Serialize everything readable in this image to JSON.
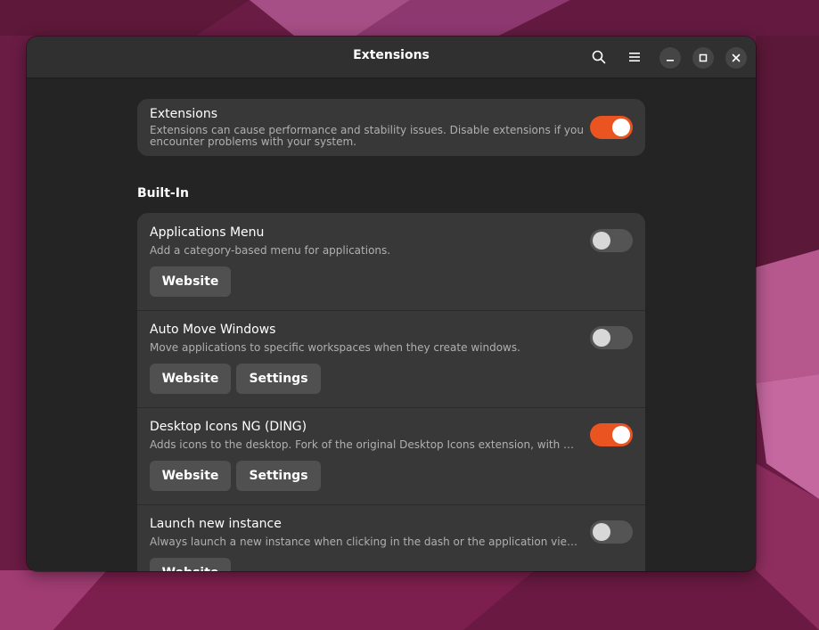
{
  "window": {
    "title": "Extensions",
    "icons": {
      "search": "search-icon",
      "menu": "hamburger-menu-icon",
      "minimize": "minimize-icon",
      "maximize": "maximize-icon",
      "close": "close-icon"
    }
  },
  "global_toggle": {
    "title": "Extensions",
    "subtitle_line1": "Extensions can cause performance and stability issues. Disable extensions if you",
    "subtitle_line2": "encounter problems with your system.",
    "enabled": true
  },
  "section": {
    "heading": "Built-In"
  },
  "extensions": [
    {
      "name": "Applications Menu",
      "description": "Add a category-based menu for applications.",
      "enabled": false,
      "website_label": "Website",
      "settings_label": ""
    },
    {
      "name": "Auto Move Windows",
      "description": "Move applications to specific workspaces when they create windows.",
      "enabled": false,
      "website_label": "Website",
      "settings_label": "Settings"
    },
    {
      "name": "Desktop Icons NG (DING)",
      "description": "Adds icons to the desktop. Fork of the original Desktop Icons extension, with several enhancements",
      "enabled": true,
      "website_label": "Website",
      "settings_label": "Settings"
    },
    {
      "name": "Launch new instance",
      "description": "Always launch a new instance when clicking in the dash or the application view.",
      "enabled": false,
      "website_label": "Website",
      "settings_label": ""
    }
  ],
  "colors": {
    "accent": "#e95420",
    "window_bg": "#242424",
    "card_bg": "#383838",
    "wallpaper": "#6e1d47"
  }
}
